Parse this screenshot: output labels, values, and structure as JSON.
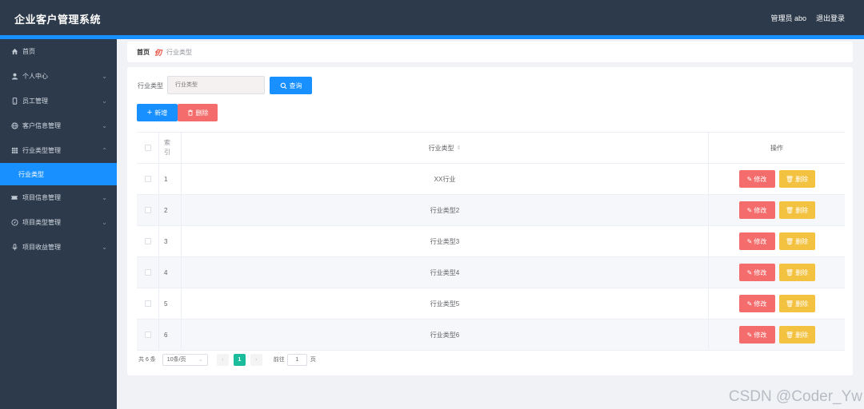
{
  "header": {
    "title": "企业客户管理系统",
    "user_label": "管理员 abo",
    "logout_label": "退出登录"
  },
  "sidebar": {
    "items": [
      {
        "label": "首页",
        "icon": "home-icon",
        "expandable": false,
        "active": false
      },
      {
        "label": "个人中心",
        "icon": "user-icon",
        "expandable": true,
        "active": false
      },
      {
        "label": "员工管理",
        "icon": "phone-icon",
        "expandable": true,
        "active": false
      },
      {
        "label": "客户信息管理",
        "icon": "globe-icon",
        "expandable": true,
        "active": false
      },
      {
        "label": "行业类型管理",
        "icon": "grid-icon",
        "expandable": true,
        "expanded": true,
        "active": false
      },
      {
        "label": "行业类型",
        "icon": "",
        "expandable": false,
        "active": true
      },
      {
        "label": "项目信息管理",
        "icon": "ticket-icon",
        "expandable": true,
        "active": false
      },
      {
        "label": "项目类型管理",
        "icon": "compass-icon",
        "expandable": true,
        "active": false
      },
      {
        "label": "项目收益管理",
        "icon": "mic-icon",
        "expandable": true,
        "active": false
      }
    ]
  },
  "breadcrumb": {
    "home": "首页",
    "separator": "仞",
    "current": "行业类型"
  },
  "search": {
    "label": "行业类型",
    "placeholder": "行业类型",
    "query_label": "查询"
  },
  "actions": {
    "add_label": "新增",
    "batch_delete_label": "删除"
  },
  "table": {
    "headers": {
      "index": "索\n引",
      "type": "行业类型",
      "ops": "操作"
    },
    "edit_label": "修改",
    "delete_label": "删除",
    "rows": [
      {
        "index": "1",
        "type": "XX行业"
      },
      {
        "index": "2",
        "type": "行业类型2"
      },
      {
        "index": "3",
        "type": "行业类型3"
      },
      {
        "index": "4",
        "type": "行业类型4"
      },
      {
        "index": "5",
        "type": "行业类型5"
      },
      {
        "index": "6",
        "type": "行业类型6"
      }
    ]
  },
  "pagination": {
    "total": "共 6 条",
    "page_size": "10条/页",
    "current_page": "1",
    "goto_prefix": "前往",
    "goto_value": "1",
    "goto_suffix": "页"
  },
  "watermark": "CSDN @Coder_Yw",
  "colors": {
    "header_bg": "#2d3a4b",
    "primary": "#1890ff",
    "danger": "#f56c6c",
    "warning": "#f3c240",
    "page_active": "#1abc9c"
  }
}
